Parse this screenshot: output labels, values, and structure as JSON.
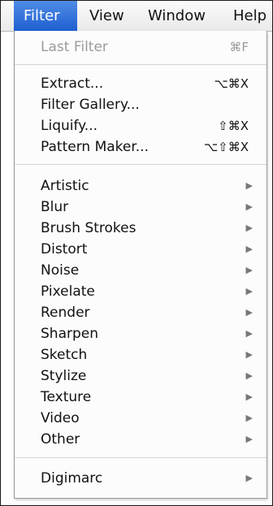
{
  "menubar": {
    "items": [
      "Filter",
      "View",
      "Window",
      "Help"
    ]
  },
  "menu": {
    "last_filter": {
      "label": "Last Filter",
      "shortcut": "⌘F"
    },
    "extract": {
      "label": "Extract...",
      "shortcut": "⌥⌘X"
    },
    "filter_gallery": {
      "label": "Filter Gallery..."
    },
    "liquify": {
      "label": "Liquify...",
      "shortcut": "⇧⌘X"
    },
    "pattern_maker": {
      "label": "Pattern Maker...",
      "shortcut": "⌥⇧⌘X"
    },
    "submenus": [
      "Artistic",
      "Blur",
      "Brush Strokes",
      "Distort",
      "Noise",
      "Pixelate",
      "Render",
      "Sharpen",
      "Sketch",
      "Stylize",
      "Texture",
      "Video",
      "Other"
    ],
    "digimarc": {
      "label": "Digimarc"
    },
    "arrow_glyph": "▶"
  }
}
